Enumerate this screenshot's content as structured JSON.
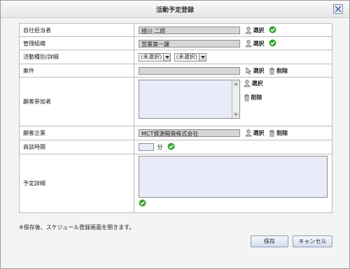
{
  "dialog": {
    "title": "活動予定登録",
    "close_icon": "close-icon"
  },
  "rows": {
    "staff": {
      "label": "自社担当者",
      "value": "綾川 二郎",
      "select": "選択"
    },
    "org": {
      "label": "管理組織",
      "value": "営業第一課",
      "select": "選択"
    },
    "activity": {
      "label": "活動種別/詳細",
      "type_value": "(未選択)",
      "detail_value": "(未選択)"
    },
    "project": {
      "label": "案件",
      "value": "",
      "select": "選択",
      "delete": "削除"
    },
    "participants": {
      "label": "顧客参加者",
      "select": "選択",
      "delete": "削除"
    },
    "company": {
      "label": "顧客企業",
      "value": "MCT資源開発株式会社",
      "select": "選択",
      "delete": "削除"
    },
    "duration": {
      "label": "商談時間",
      "value": "",
      "unit": "分"
    },
    "details": {
      "label": "予定詳細",
      "value": ""
    }
  },
  "footer": {
    "note": "※保存後、スケジュール登録画面を閉きます。",
    "save_label": "保存",
    "cancel_label": "キャンセル"
  },
  "colors": {
    "ok": "#3aa62f",
    "field_readonly": "#d6d6d6",
    "field_input": "#e8ecf8"
  }
}
